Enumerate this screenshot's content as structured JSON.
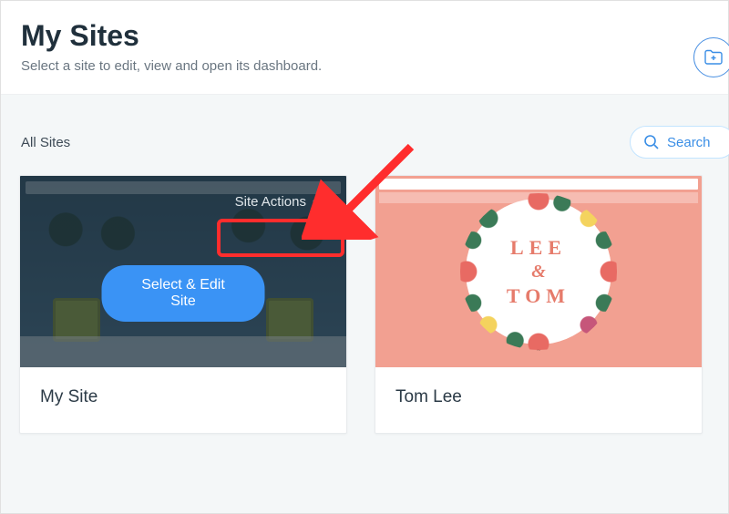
{
  "header": {
    "title": "My Sites",
    "subtitle": "Select a site to edit, view and open its dashboard."
  },
  "filter": {
    "all_label": "All Sites",
    "search_placeholder": "Search"
  },
  "cards": [
    {
      "site_actions_label": "Site Actions",
      "select_label": "Select & Edit Site",
      "name": "My Site"
    },
    {
      "logo_line1": "LEE",
      "logo_amp": "&",
      "logo_line2": "TOM",
      "name": "Tom Lee"
    }
  ],
  "colors": {
    "accent_blue": "#3a93f5",
    "annotation_red": "#ff2d2d"
  }
}
